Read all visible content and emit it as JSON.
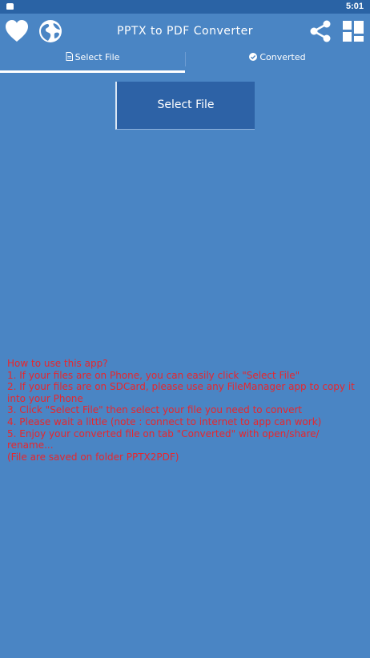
{
  "status_bar": {
    "time": "5:01"
  },
  "app_bar": {
    "title": "PPTX to PDF Converter",
    "icons": {
      "favorite": "heart-icon",
      "web": "globe-icon",
      "share": "share-icon",
      "more_apps": "apps-grid-icon"
    }
  },
  "tabs": [
    {
      "label": "Select File",
      "icon": "file-icon",
      "selected": true
    },
    {
      "label": "Converted",
      "icon": "check-circle-icon",
      "selected": false
    }
  ],
  "main": {
    "select_button_label": "Select File"
  },
  "instructions": {
    "lines": [
      "How to use this app?",
      "1. If your files are on Phone, you can easily click \"Select File\"",
      "2. If your files are on SDCard, please use any FileManager app to copy it into your Phone",
      "3. Click \"Select File\" then select your file you need to convert",
      "4. Please wait a little (note : connect to internet to app can work)",
      "5. Enjoy your converted file on tab \"Converted\" with open/share/ rename...",
      "(File are saved on folder PPTX2PDF)"
    ]
  },
  "colors": {
    "background": "#4a85c4",
    "status_bar": "#2a63a5",
    "button": "#2d62a6",
    "instruction_text": "#e8262c"
  }
}
